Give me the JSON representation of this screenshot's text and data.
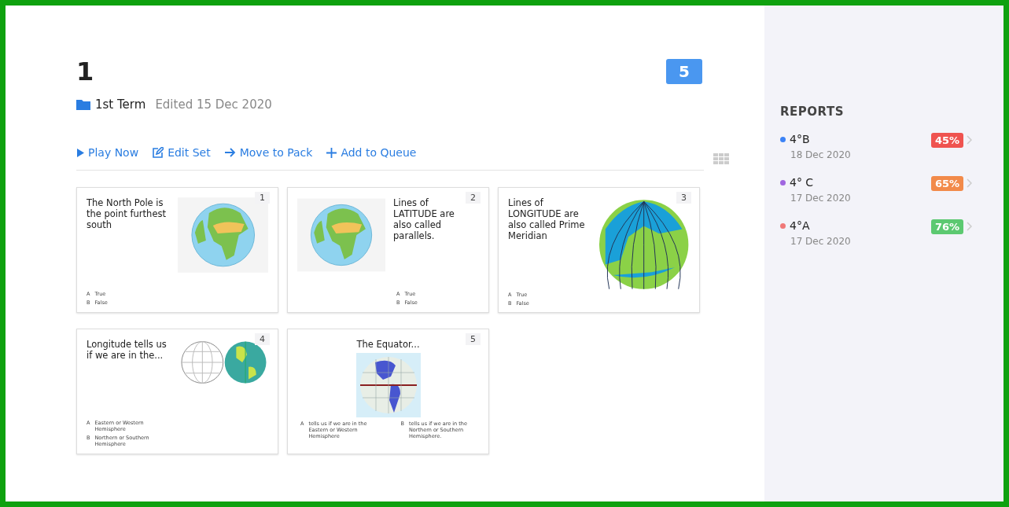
{
  "title": "1",
  "count_badge": "5",
  "meta": {
    "folder": "1st Term",
    "edited": "Edited 15 Dec 2020"
  },
  "actions": [
    {
      "kind": "play",
      "label": "Play Now"
    },
    {
      "kind": "edit",
      "label": "Edit Set"
    },
    {
      "kind": "move",
      "label": "Move to Pack"
    },
    {
      "kind": "add",
      "label": "Add to Queue"
    }
  ],
  "questions": [
    {
      "number": "1",
      "kind": "globe",
      "question": "The North Pole is the point furthest south",
      "answers": [
        {
          "letter": "A",
          "text": "True"
        },
        {
          "letter": "B",
          "text": "False"
        }
      ]
    },
    {
      "number": "2",
      "kind": "mirrored",
      "question": "Lines of LATITUDE are also called parallels.",
      "answers": [
        {
          "letter": "A",
          "text": "True"
        },
        {
          "letter": "B",
          "text": "False"
        }
      ]
    },
    {
      "number": "3",
      "kind": "striped",
      "question": "Lines of LONGITUDE are also called Prime Meridian",
      "answers": [
        {
          "letter": "A",
          "text": "True"
        },
        {
          "letter": "B",
          "text": "False"
        }
      ]
    },
    {
      "number": "4",
      "kind": "pair",
      "question": "Longitude tells us if we are in the...",
      "answers": [
        {
          "letter": "A",
          "text": "Eastern or Western Hemisphere"
        },
        {
          "letter": "B",
          "text": "Northern or Southern Hemisphere"
        }
      ]
    },
    {
      "number": "5",
      "kind": "grid",
      "question": "The Equator...",
      "answers": [
        {
          "letter": "A",
          "text": "tells us if we are in the Eastern or Western Hemisphere"
        },
        {
          "letter": "B",
          "text": "tells us if we are in the Northern or Southern Hemisphere."
        }
      ]
    }
  ],
  "reports": {
    "heading": "REPORTS",
    "items": [
      {
        "name": "4°B",
        "date": "18 Dec 2020",
        "score": "45%",
        "color": "#3b82f6",
        "kind": "low"
      },
      {
        "name": "4° C",
        "date": "17 Dec 2020",
        "score": "65%",
        "color": "#a066e0",
        "kind": "medium"
      },
      {
        "name": "4°A",
        "date": "17 Dec 2020",
        "score": "76%",
        "color": "#f07878",
        "kind": "high"
      }
    ]
  }
}
